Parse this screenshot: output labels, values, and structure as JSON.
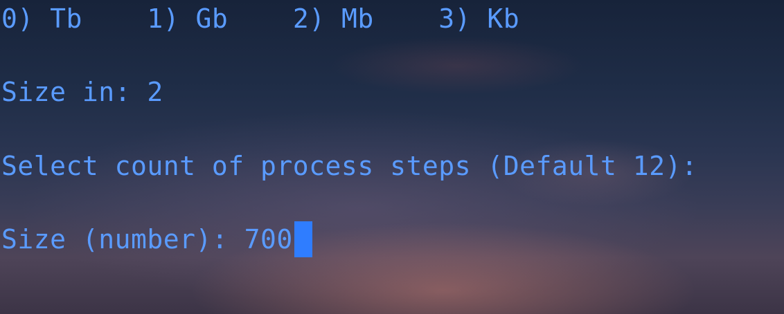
{
  "terminal": {
    "unit_options": [
      {
        "label": "0) Tb"
      },
      {
        "label": "1) Gb"
      },
      {
        "label": "2) Mb"
      },
      {
        "label": "3) Kb"
      }
    ],
    "size_in_line": "Size in: 2",
    "steps_prompt": "Select count of process steps (Default 12):",
    "size_prompt": "Size (number): ",
    "size_input_value": "700",
    "text_color": "#5a9bff",
    "cursor_color": "#2f7dff"
  }
}
